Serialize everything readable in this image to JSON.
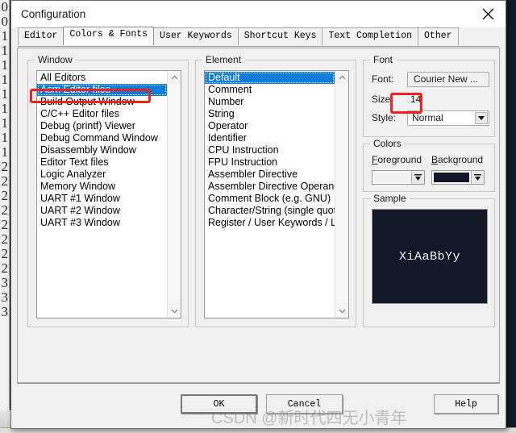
{
  "window": {
    "title": "Configuration",
    "close_icon": "close-icon"
  },
  "tabs": [
    {
      "label": "Editor",
      "active": false
    },
    {
      "label": "Colors & Fonts",
      "active": true
    },
    {
      "label": "User Keywords",
      "active": false
    },
    {
      "label": "Shortcut Keys",
      "active": false
    },
    {
      "label": "Text Completion",
      "active": false
    },
    {
      "label": "Other",
      "active": false
    }
  ],
  "window_group": {
    "title": "Window",
    "items": [
      {
        "label": "All Editors",
        "selected": false
      },
      {
        "label": "Asm Editor files",
        "selected": true
      },
      {
        "label": "Build Output Window",
        "selected": false
      },
      {
        "label": "C/C++ Editor files",
        "selected": false
      },
      {
        "label": "Debug (printf) Viewer",
        "selected": false
      },
      {
        "label": "Debug Command Window",
        "selected": false
      },
      {
        "label": "Disassembly Window",
        "selected": false
      },
      {
        "label": "Editor Text files",
        "selected": false
      },
      {
        "label": "Logic Analyzer",
        "selected": false
      },
      {
        "label": "Memory Window",
        "selected": false
      },
      {
        "label": "UART #1 Window",
        "selected": false
      },
      {
        "label": "UART #2 Window",
        "selected": false
      },
      {
        "label": "UART #3 Window",
        "selected": false
      }
    ],
    "scroll_up_icon": "chevron-up-icon",
    "scroll_down_icon": "chevron-down-icon"
  },
  "element_group": {
    "title": "Element",
    "items": [
      {
        "label": "Default",
        "selected": true
      },
      {
        "label": "Comment",
        "selected": false
      },
      {
        "label": "Number",
        "selected": false
      },
      {
        "label": "String",
        "selected": false
      },
      {
        "label": "Operator",
        "selected": false
      },
      {
        "label": "Identifier",
        "selected": false
      },
      {
        "label": "CPU Instruction",
        "selected": false
      },
      {
        "label": "FPU Instruction",
        "selected": false
      },
      {
        "label": "Assembler Directive",
        "selected": false
      },
      {
        "label": "Assembler Directive Operand",
        "selected": false
      },
      {
        "label": "Comment Block (e.g. GNU)",
        "selected": false
      },
      {
        "label": "Character/String (single quote)",
        "selected": false
      },
      {
        "label": "Register / User Keywords / Label",
        "selected": false
      }
    ],
    "scroll_up_icon": "chevron-up-icon",
    "scroll_down_icon": "chevron-down-icon"
  },
  "font_group": {
    "title": "Font",
    "font_label": "Font:",
    "font_value": "Courier New ...",
    "size_label": "Size:",
    "size_value": "14",
    "style_label": "Style:",
    "style_value": "Normal",
    "style_dropdown_icon": "chevron-down-icon"
  },
  "colors_group": {
    "title": "Colors",
    "foreground_label": "Foreground",
    "background_label": "Background",
    "foreground_color": "#f2f2f2",
    "background_color": "#111827",
    "dropdown_icon": "color-dropdown-icon"
  },
  "sample_group": {
    "title": "Sample",
    "text": "XiAaBbYy",
    "text_color": "#f2f2f2",
    "bg_color": "#111827"
  },
  "footer": {
    "ok_label": "OK",
    "cancel_label": "Cancel",
    "help_label": "Help"
  },
  "annotations": {
    "color": "#ef2222",
    "boxes": [
      "asm-editor-files-highlight",
      "font-size-highlight"
    ]
  },
  "watermark": {
    "text": "CSDN @新时代四无小青年"
  },
  "background_editor": {
    "gutter_numbers": [
      "0",
      "0",
      "1",
      "1",
      "1",
      "1",
      "1",
      "1",
      "1",
      "1",
      "1",
      "2",
      "2",
      "2",
      "2",
      "2",
      "2",
      "2",
      "2",
      "3",
      "3",
      "3"
    ],
    "bg_color": "#10192a"
  }
}
